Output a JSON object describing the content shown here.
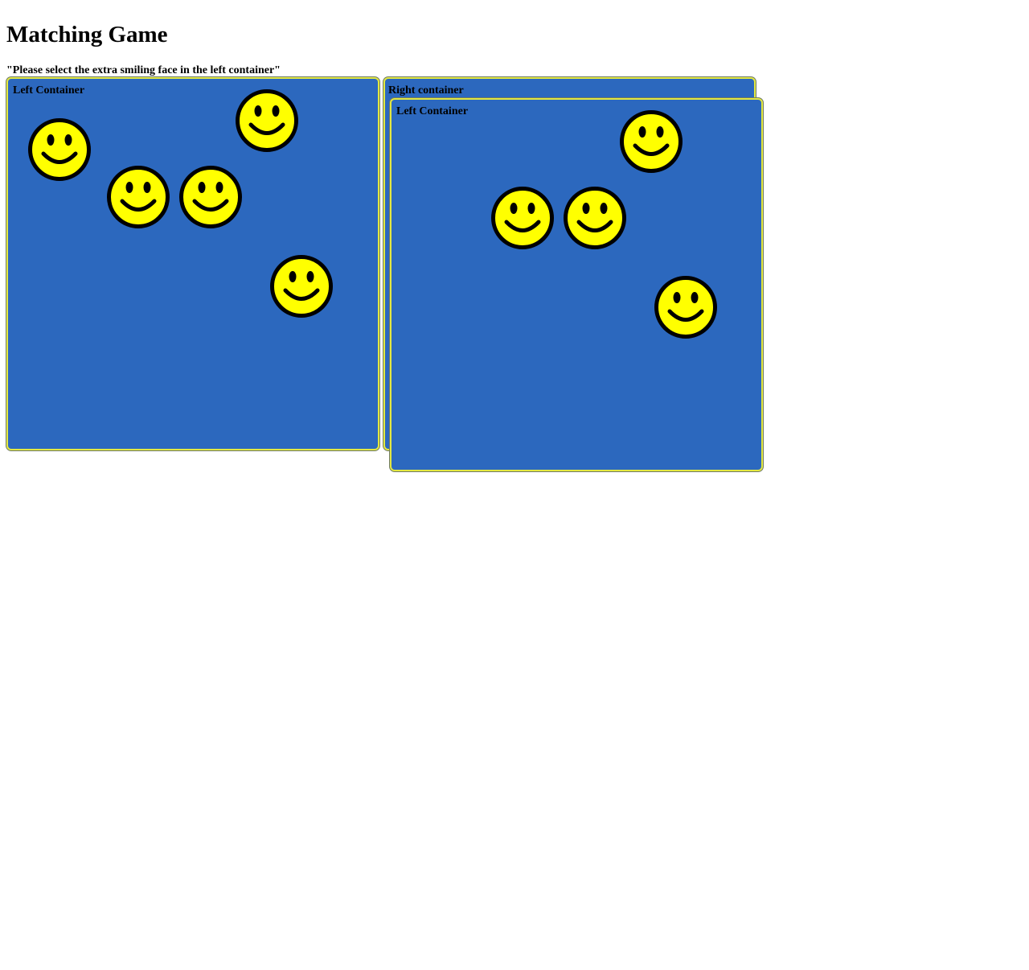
{
  "page": {
    "title": "Matching Game",
    "instruction": "\"Please select the extra smiling face in the left container\""
  },
  "left_container": {
    "label": "Left Container",
    "faces": [
      "smiley-face-icon",
      "smiley-face-icon",
      "smiley-face-icon",
      "smiley-face-icon",
      "smiley-face-icon"
    ]
  },
  "right_container": {
    "label": "Right container",
    "inner_container": {
      "label": "Left Container",
      "faces": [
        "smiley-face-icon",
        "smiley-face-icon",
        "smiley-face-icon",
        "smiley-face-icon"
      ]
    }
  },
  "colors": {
    "container_fill": "#2c68be",
    "container_border": "#e3e842",
    "face_fill": "#ffff00",
    "face_outline": "#000000"
  }
}
